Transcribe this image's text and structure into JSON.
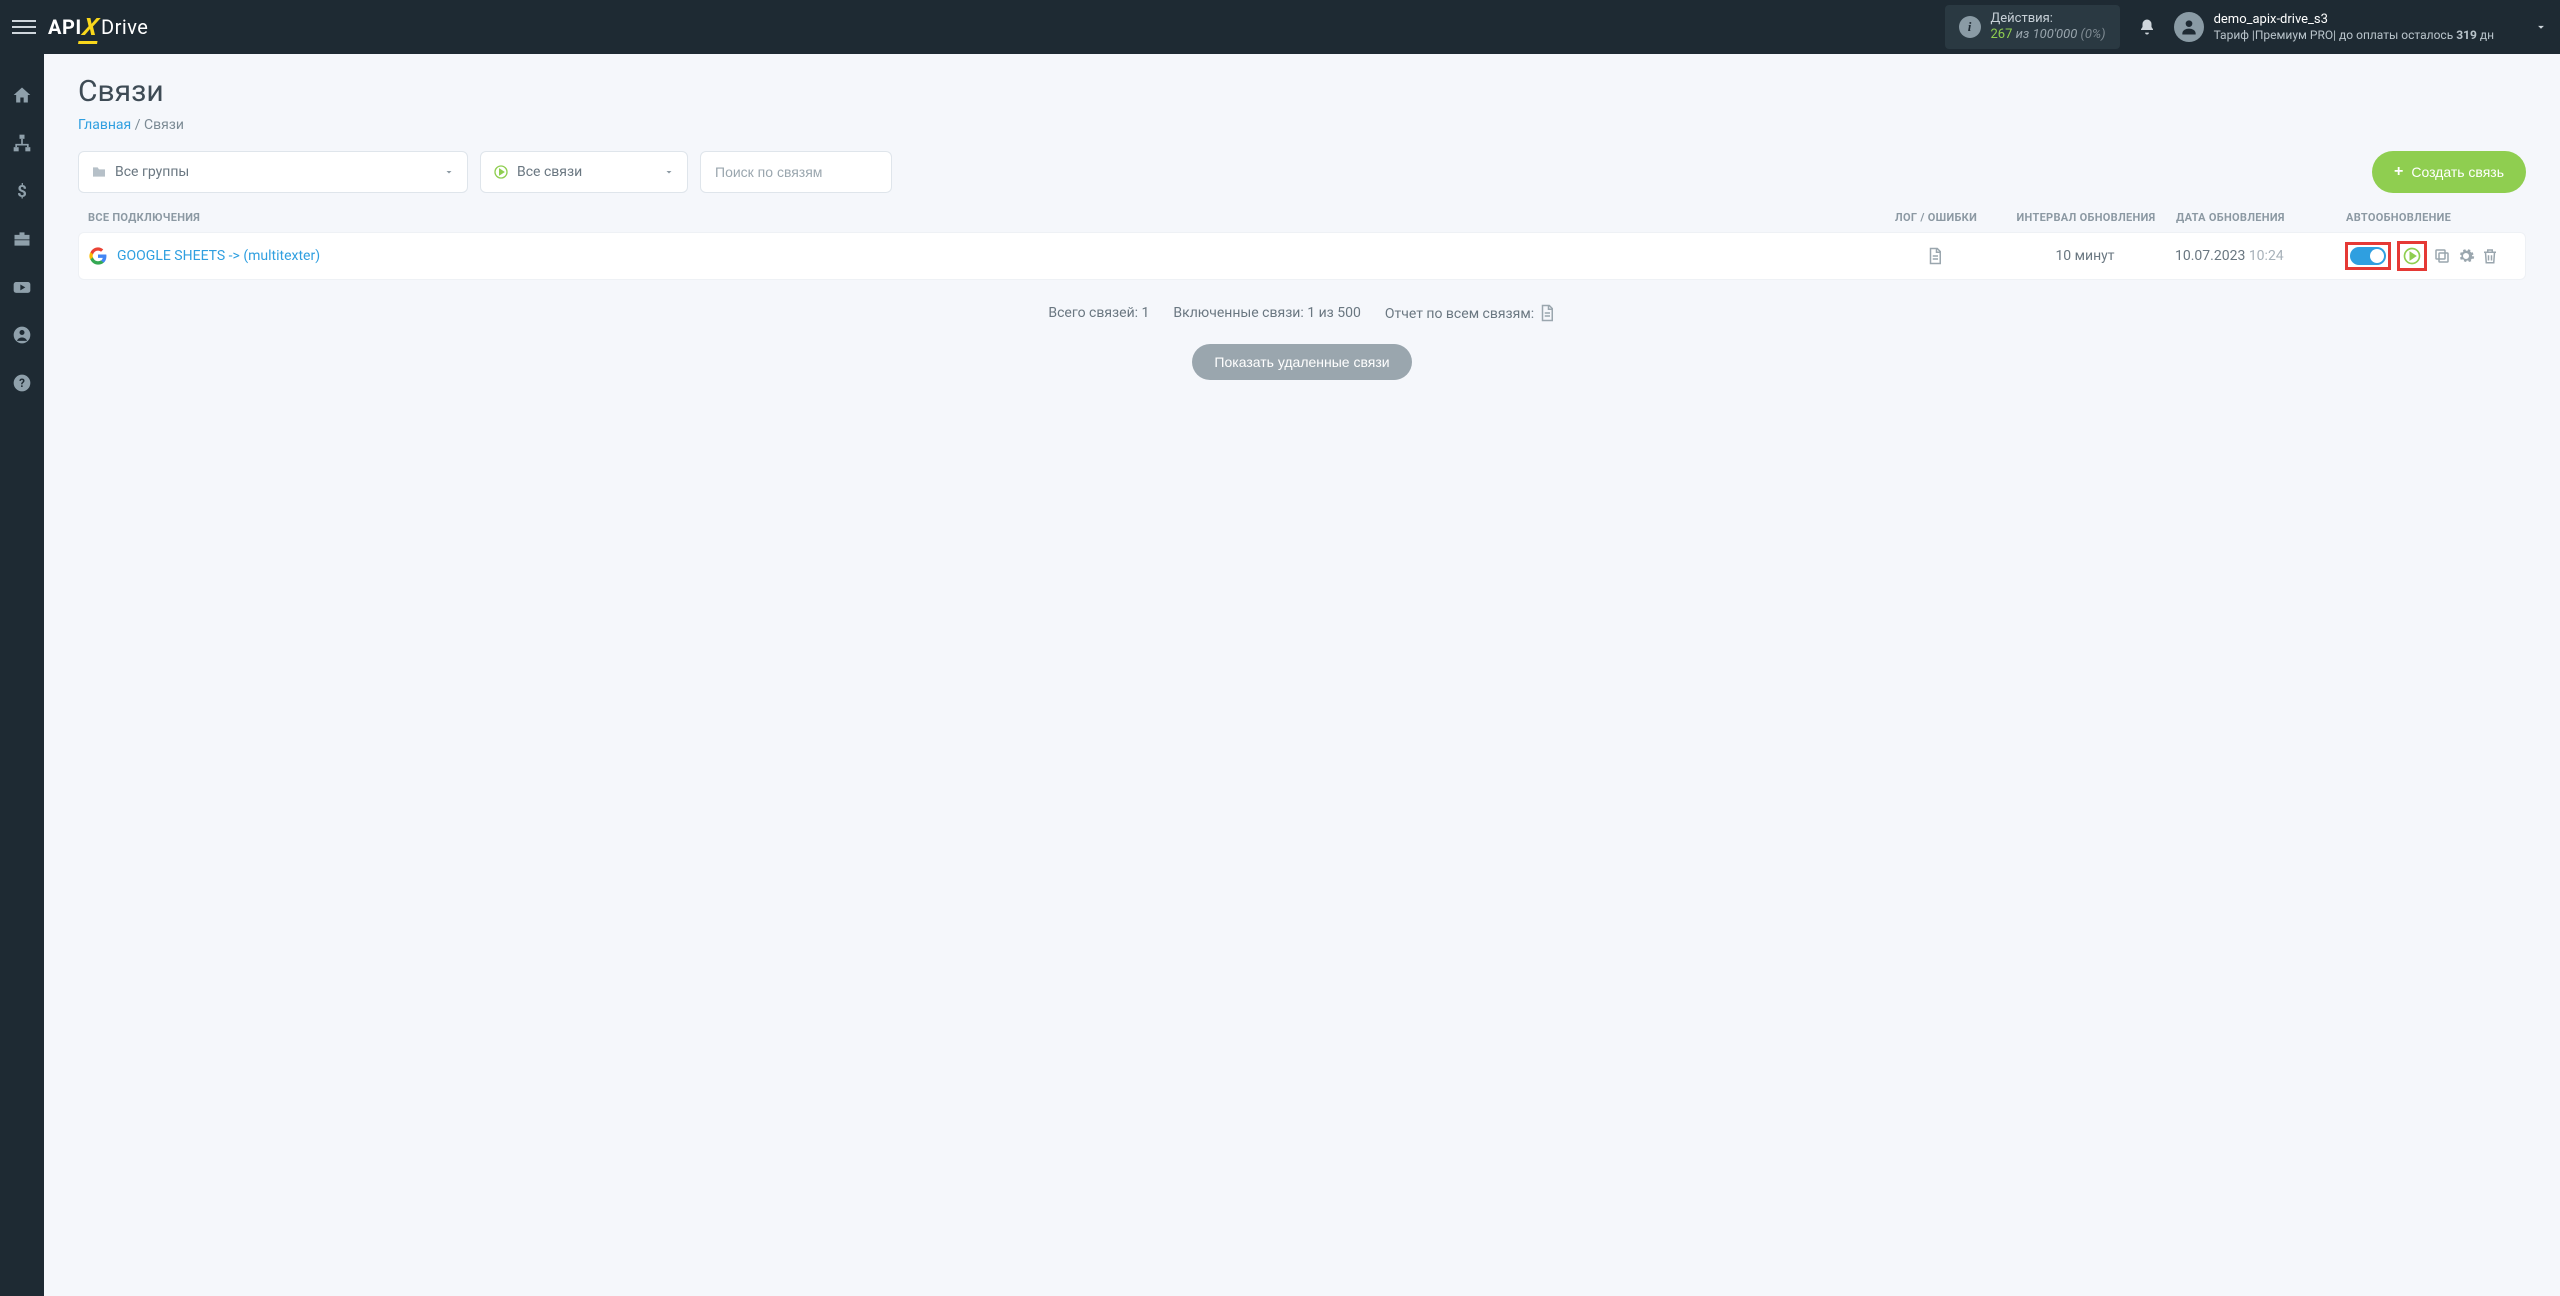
{
  "header": {
    "status_label": "Действия:",
    "status_count": "267",
    "status_of_word": "из",
    "status_total": "100'000",
    "status_pct": "(0%)",
    "username": "demo_apix-drive_s3",
    "tariff_prefix": "Тариф |Премиум PRO|",
    "tariff_mid": " до оплаты осталось ",
    "tariff_days": "319",
    "tariff_suffix": " дн"
  },
  "page": {
    "title": "Связи",
    "breadcrumb_home": "Главная",
    "breadcrumb_sep": " / ",
    "breadcrumb_current": "Связи"
  },
  "filters": {
    "groups": "Все группы",
    "links": "Все связи",
    "search_placeholder": "Поиск по связям",
    "create_btn": "Создать связь"
  },
  "table": {
    "head_all": "ВСЕ ПОДКЛЮЧЕНИЯ",
    "head_log": "ЛОГ / ОШИБКИ",
    "head_interval": "ИНТЕРВАЛ ОБНОВЛЕНИЯ",
    "head_date": "ДАТА ОБНОВЛЕНИЯ",
    "head_auto": "АВТООБНОВЛЕНИЕ",
    "rows": [
      {
        "name": "GOOGLE SHEETS -> (multitexter)",
        "interval": "10 минут",
        "date": "10.07.2023",
        "time": "10:24"
      }
    ]
  },
  "summary": {
    "total": "Всего связей: 1",
    "enabled": "Включенные связи: 1 из 500",
    "report": "Отчет по всем связям:"
  },
  "buttons": {
    "show_deleted": "Показать удаленные связи"
  }
}
